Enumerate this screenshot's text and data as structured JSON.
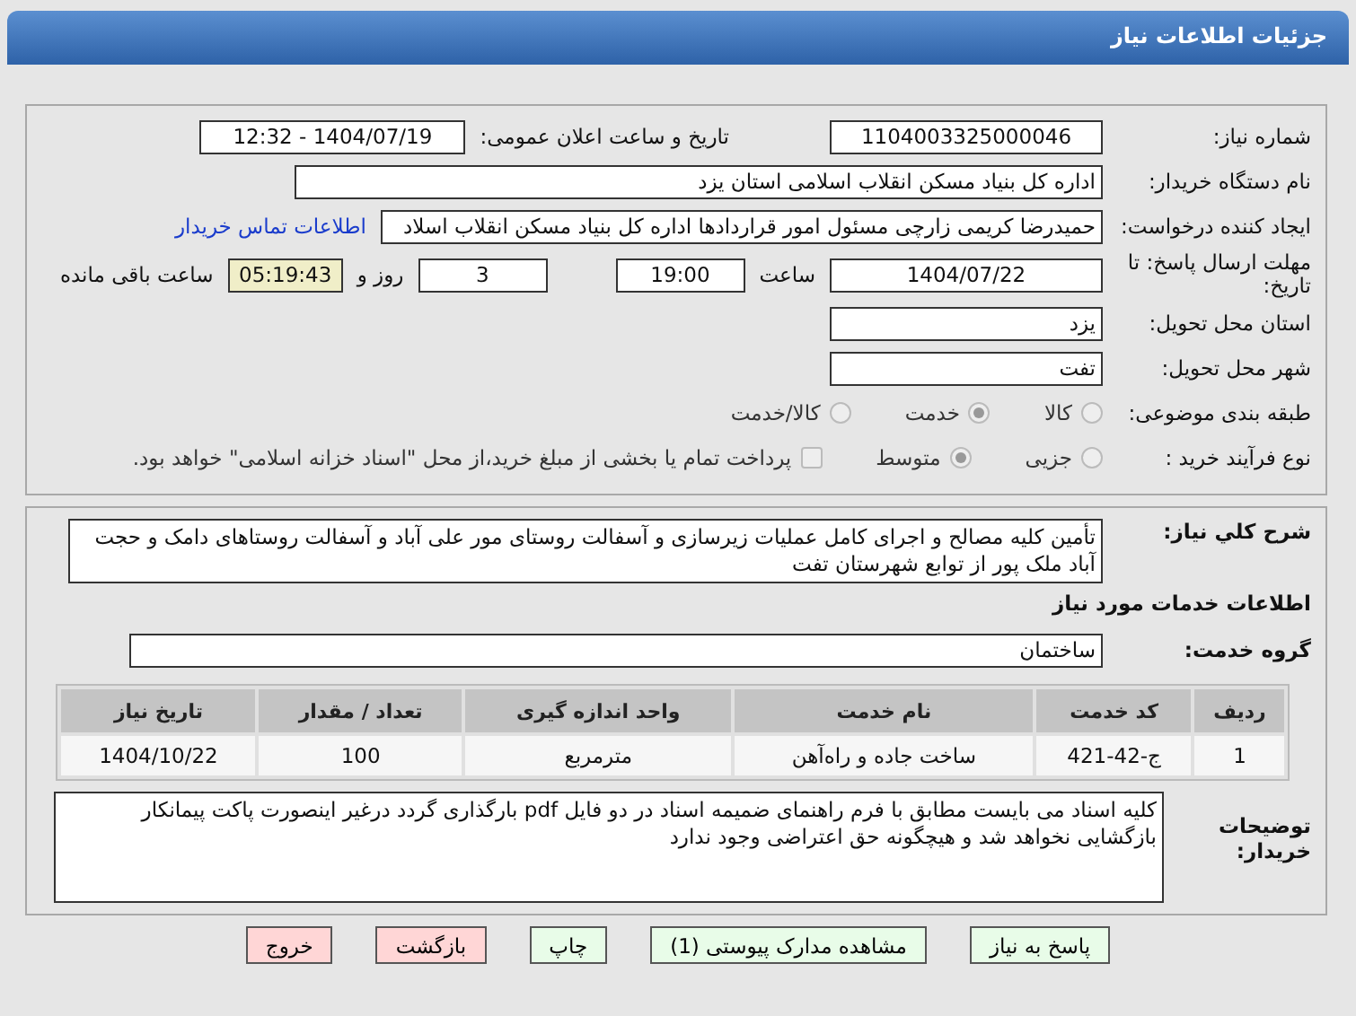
{
  "header": {
    "title": "جزئیات اطلاعات نیاز"
  },
  "form": {
    "need_number": {
      "label": "شماره نیاز:",
      "value": "1104003325000046"
    },
    "announce": {
      "label": "تاریخ و ساعت اعلان عمومی:",
      "value": "1404/07/19 - 12:32"
    },
    "buyer": {
      "label": "نام دستگاه خریدار:",
      "value": "اداره کل بنیاد مسکن انقلاب اسلامی استان یزد"
    },
    "creator": {
      "label": "ایجاد کننده درخواست:",
      "value": "حمیدرضا کریمی زارچی مسئول امور قراردادها اداره کل بنیاد مسکن انقلاب اسلاد",
      "link": "اطلاعات تماس خریدار"
    },
    "deadline": {
      "label": "مهلت ارسال پاسخ: تا تاریخ:",
      "date": "1404/07/22",
      "time_label": "ساعت",
      "time": "19:00",
      "days": "3",
      "days_label": "روز و",
      "remaining": "05:19:43",
      "remaining_label": "ساعت باقی مانده"
    },
    "province": {
      "label": "استان محل تحویل:",
      "value": "یزد"
    },
    "city": {
      "label": "شهر محل تحویل:",
      "value": "تفت"
    },
    "category": {
      "label": "طبقه بندی موضوعی:",
      "options": [
        {
          "label": "کالا",
          "selected": false
        },
        {
          "label": "خدمت",
          "selected": true
        },
        {
          "label": "کالا/خدمت",
          "selected": false
        }
      ]
    },
    "process": {
      "label": "نوع فرآیند خرید :",
      "options": [
        {
          "label": "جزیی",
          "selected": false
        },
        {
          "label": "متوسط",
          "selected": true
        }
      ],
      "checkbox": {
        "label": "پرداخت تمام یا بخشی از مبلغ خرید،از محل \"اسناد خزانه اسلامی\" خواهد بود.",
        "checked": false
      }
    }
  },
  "description": {
    "label": "شرح کلي نياز:",
    "value": "تأمین کلیه مصالح و اجرای کامل عملیات زیرسازی و آسفالت روستای مور علی آباد و آسفالت روستاهای دامک و حجت آباد ملک پور از توابع شهرستان تفت"
  },
  "services_title": "اطلاعات خدمات مورد نیاز",
  "service_group": {
    "label": "گروه خدمت:",
    "value": "ساختمان"
  },
  "table": {
    "columns": [
      "ردیف",
      "کد خدمت",
      "نام خدمت",
      "واحد اندازه گیری",
      "تعداد / مقدار",
      "تاریخ نیاز"
    ],
    "rows": [
      [
        "1",
        "ج-42-421",
        "ساخت جاده و راه‌آهن",
        "مترمربع",
        "100",
        "1404/10/22"
      ]
    ]
  },
  "buyer_notes": {
    "label": "توضیحات خریدار:",
    "value": "کلیه اسناد می بایست مطابق با فرم راهنمای ضمیمه اسناد در دو فایل pdf بارگذاری گردد درغیر اینصورت  پاکت پیمانکار بازگشایی نخواهد شد و هیچگونه حق اعتراضی وجود ندارد"
  },
  "buttons": [
    {
      "label": "پاسخ به نیاز",
      "kind": "action"
    },
    {
      "label": "مشاهده مدارک پیوستی (1)",
      "kind": "action"
    },
    {
      "label": "چاپ",
      "kind": "action"
    },
    {
      "label": "بازگشت",
      "kind": "exit"
    },
    {
      "label": "خروج",
      "kind": "exit"
    }
  ]
}
